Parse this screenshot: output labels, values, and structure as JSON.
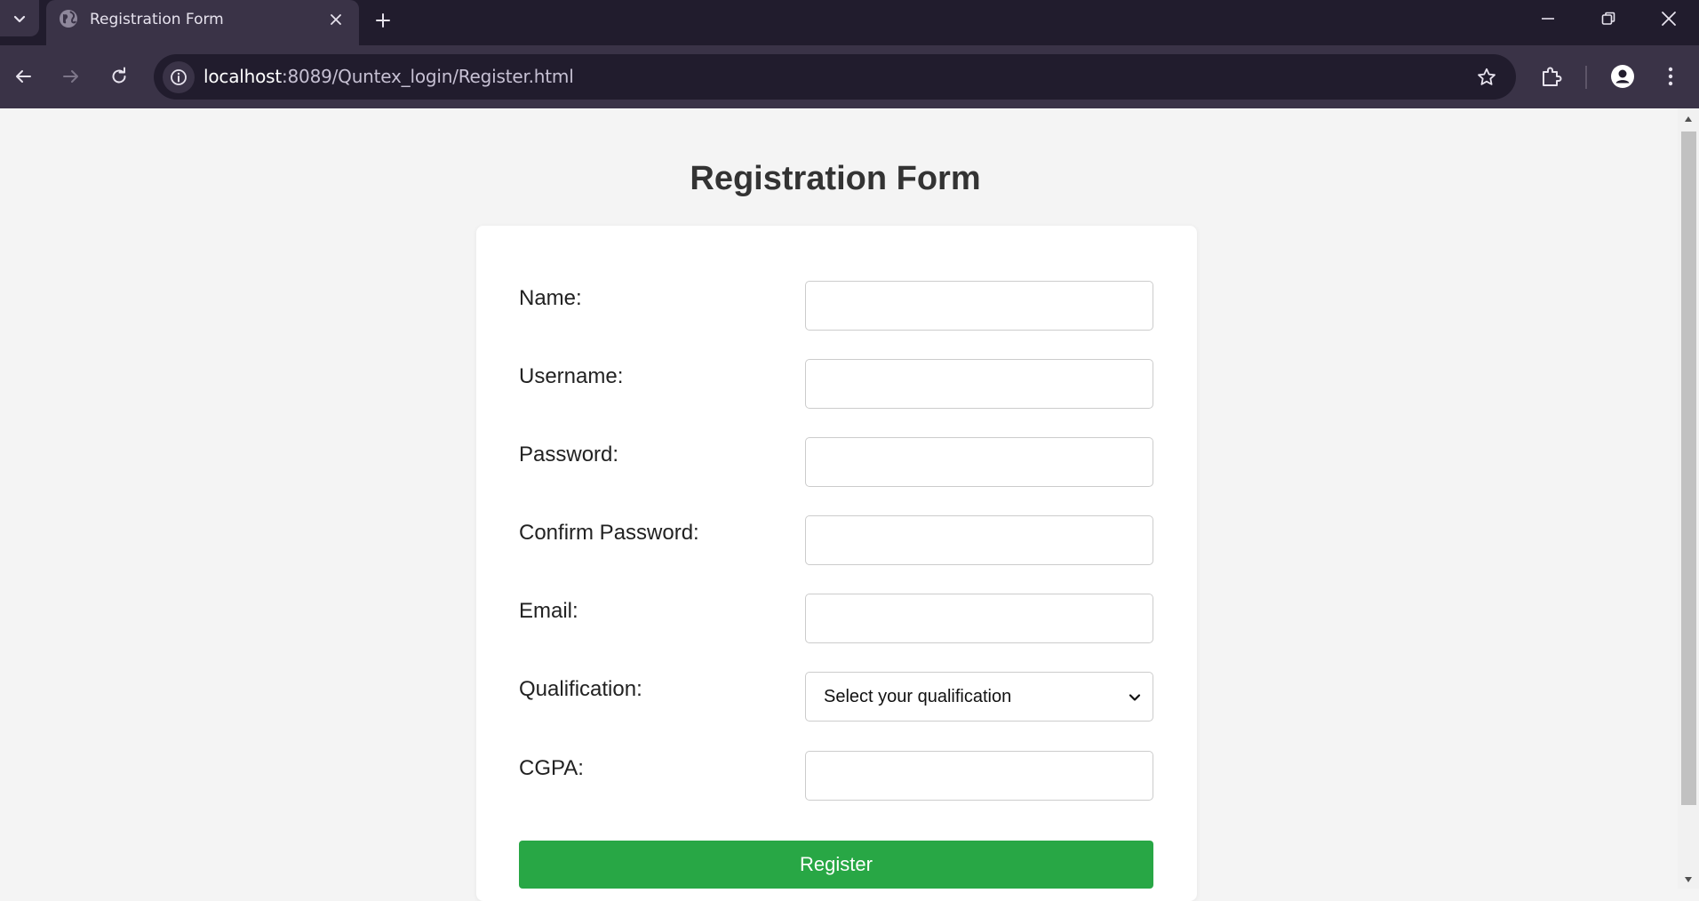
{
  "browser": {
    "tab_title": "Registration Form",
    "url_host": "localhost",
    "url_rest": ":8089/Quntex_login/Register.html"
  },
  "page": {
    "title": "Registration Form"
  },
  "form": {
    "fields": [
      {
        "label": "Name:",
        "value": ""
      },
      {
        "label": "Username:",
        "value": ""
      },
      {
        "label": "Password:",
        "value": ""
      },
      {
        "label": "Confirm Password:",
        "value": ""
      },
      {
        "label": "Email:",
        "value": ""
      },
      {
        "label": "Qualification:",
        "selected": "Select your qualification"
      },
      {
        "label": "CGPA:",
        "value": ""
      }
    ],
    "submit_label": "Register"
  },
  "colors": {
    "accent": "#28a745",
    "chrome_dark": "#211c2d",
    "chrome_light": "#3a3347"
  }
}
